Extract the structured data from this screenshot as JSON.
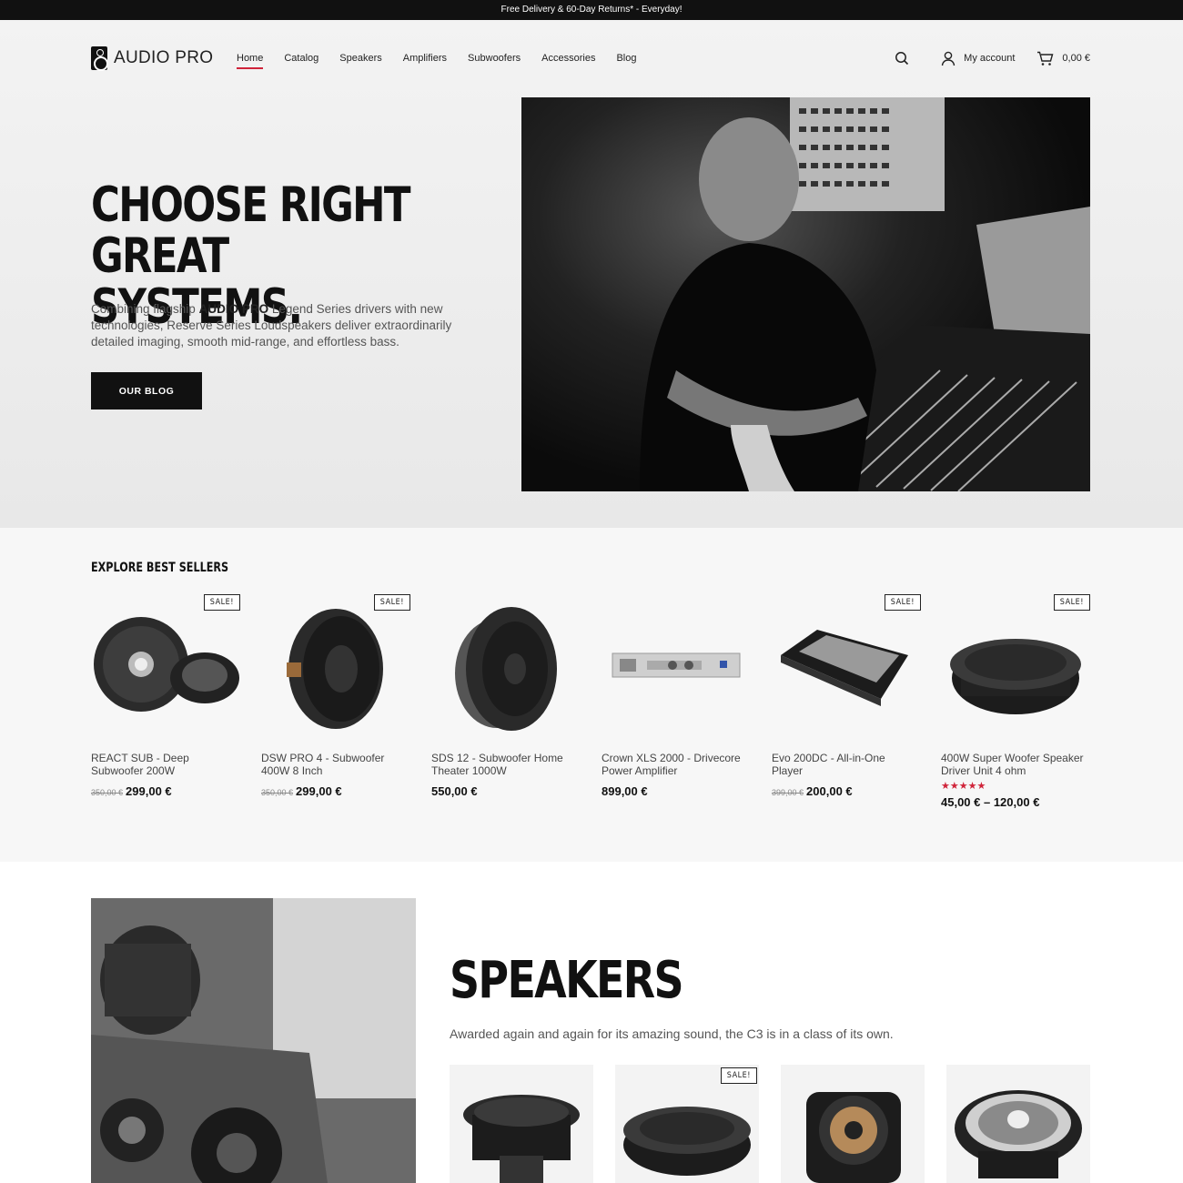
{
  "topbar": {
    "text": "Free Delivery & 60-Day Returns* - Everyday!"
  },
  "header": {
    "logo_text": "AUDIO PRO",
    "nav": [
      {
        "label": "Home",
        "active": true
      },
      {
        "label": "Catalog"
      },
      {
        "label": "Speakers"
      },
      {
        "label": "Amplifiers"
      },
      {
        "label": "Subwoofers"
      },
      {
        "label": "Accessories"
      },
      {
        "label": "Blog"
      }
    ],
    "account_label": "My account",
    "cart_total": "0,00 €",
    "icons": [
      "search-icon",
      "user-icon",
      "cart-icon"
    ]
  },
  "hero": {
    "title_line1": "CHOOSE RIGHT",
    "title_line2": "GREAT SYSTEMS.",
    "text_before": "Combining flagship ",
    "text_brand": "AUDIO PRO",
    "text_after": " Legend Series drivers with new technologies, Reserve Series Loudspeakers deliver extraordinarily detailed imaging, smooth mid-range, and effortless bass.",
    "button": "OUR BLOG"
  },
  "bestsellers": {
    "title": "EXPLORE BEST SELLERS",
    "products": [
      {
        "name_line1": "REACT SUB - Deep",
        "name_line2": "Subwoofer 200W",
        "old_price": "350,00 €",
        "price": "299,00 €",
        "sale": "SALE!"
      },
      {
        "name_line1": "DSW PRO 4 - Subwoofer",
        "name_line2": "400W 8 Inch",
        "old_price": "350,00 €",
        "price": "299,00 €",
        "sale": "SALE!"
      },
      {
        "name_line1": "SDS 12 - Subwoofer Home",
        "name_line2": "Theater 1000W",
        "old_price": "",
        "price": "550,00 €",
        "sale": ""
      },
      {
        "name_line1": "Crown XLS 2000 - Drivecore",
        "name_line2": "Power Amplifier",
        "old_price": "",
        "price": "899,00 €",
        "sale": ""
      },
      {
        "name_line1": "Evo 200DC - All-in-One",
        "name_line2": "Player",
        "old_price": "399,00 €",
        "price": "200,00 €",
        "sale": "SALE!"
      },
      {
        "name_line1": "400W Super Woofer Speaker",
        "name_line2": "Driver Unit 4 ohm",
        "old_price": "",
        "price": "45,00 € – 120,00 €",
        "sale": "SALE!",
        "rating": 5
      }
    ]
  },
  "speakers": {
    "title": "SPEAKERS",
    "subtitle": "Awarded again and again for its amazing sound, the C3 is in a class of its own.",
    "card_sale": "SALE!"
  },
  "colors": {
    "accent": "#d0243a",
    "dark": "#111111",
    "hero_bg": "#efefef",
    "section_bg": "#f7f7f7"
  }
}
